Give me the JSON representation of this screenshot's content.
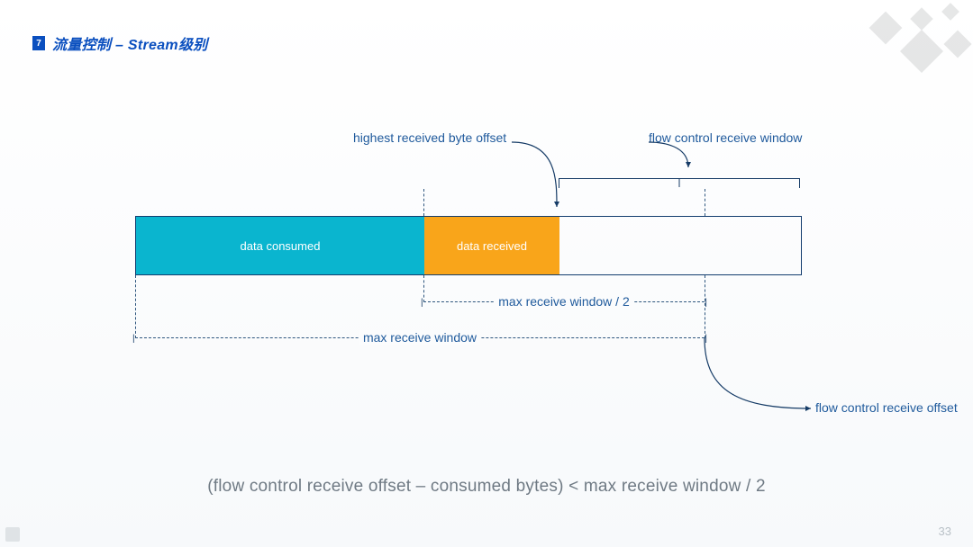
{
  "page": {
    "section_number": "7",
    "title": "流量控制 – Stream级别",
    "page_number": "33"
  },
  "diagram": {
    "segments": {
      "consumed": "data consumed",
      "received": "data received"
    },
    "labels": {
      "highest_offset": "highest received byte offset",
      "flow_window": "flow control receive window",
      "half_window": "max receive window / 2",
      "max_window": "max receive window",
      "flow_offset": "flow control receive offset"
    },
    "formula": "(flow control receive offset – consumed bytes) < max receive window / 2"
  }
}
